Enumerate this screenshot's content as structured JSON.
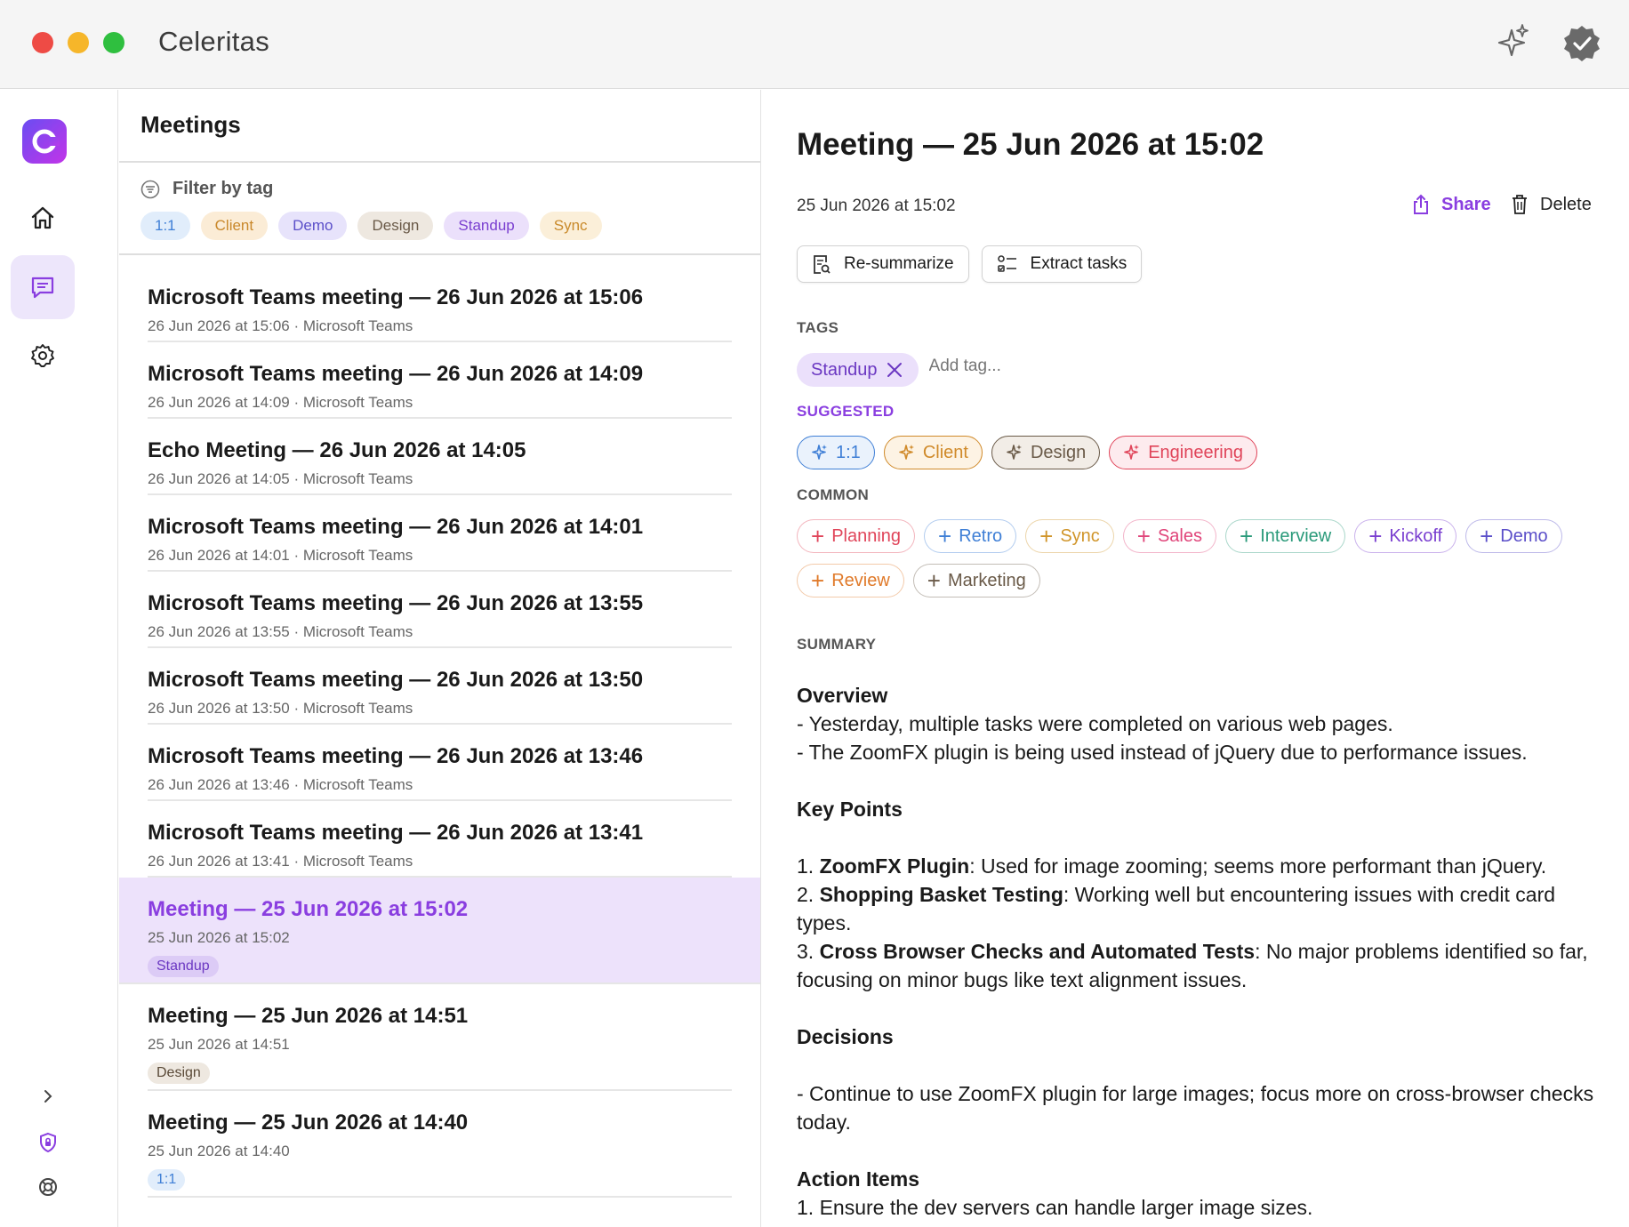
{
  "app": {
    "title": "Celeritas"
  },
  "list": {
    "header": "Meetings",
    "filter_label": "Filter by tag",
    "filter_tags": [
      {
        "label": "1:1",
        "bg": "#e1edfb",
        "fg": "#3f7fd6"
      },
      {
        "label": "Client",
        "bg": "#fbecd6",
        "fg": "#c9882b"
      },
      {
        "label": "Demo",
        "bg": "#e7e3fb",
        "fg": "#5b4fc9"
      },
      {
        "label": "Design",
        "bg": "#eee8e0",
        "fg": "#6a5a48"
      },
      {
        "label": "Standup",
        "bg": "#ebe0fb",
        "fg": "#7a3fd0"
      },
      {
        "label": "Sync",
        "bg": "#fbefd9",
        "fg": "#c98a2b"
      }
    ],
    "meetings": [
      {
        "title": "Microsoft Teams meeting — 26 Jun 2026 at 15:06",
        "sub": "26 Jun 2026 at 15:06 · Microsoft Teams"
      },
      {
        "title": "Microsoft Teams meeting — 26 Jun 2026 at 14:09",
        "sub": "26 Jun 2026 at 14:09 · Microsoft Teams"
      },
      {
        "title": "Echo Meeting — 26 Jun 2026 at 14:05",
        "sub": "26 Jun 2026 at 14:05 · Microsoft Teams"
      },
      {
        "title": "Microsoft Teams meeting — 26 Jun 2026 at 14:01",
        "sub": "26 Jun 2026 at 14:01 · Microsoft Teams"
      },
      {
        "title": "Microsoft Teams meeting — 26 Jun 2026 at 13:55",
        "sub": "26 Jun 2026 at 13:55 · Microsoft Teams"
      },
      {
        "title": "Microsoft Teams meeting — 26 Jun 2026 at 13:50",
        "sub": "26 Jun 2026 at 13:50 · Microsoft Teams"
      },
      {
        "title": "Microsoft Teams meeting — 26 Jun 2026 at 13:46",
        "sub": "26 Jun 2026 at 13:46 · Microsoft Teams"
      },
      {
        "title": "Microsoft Teams meeting — 26 Jun 2026 at 13:41",
        "sub": "26 Jun 2026 at 13:41 · Microsoft Teams"
      },
      {
        "title": "Meeting — 25 Jun 2026 at 15:02",
        "sub": "25 Jun 2026 at 15:02",
        "tag": "Standup",
        "tag_bg": "#dccbf6",
        "tag_fg": "#6b38c2"
      },
      {
        "title": "Meeting — 25 Jun 2026 at 14:51",
        "sub": "25 Jun 2026 at 14:51",
        "tag": "Design",
        "tag_bg": "#eee8e0",
        "tag_fg": "#5a4a38"
      },
      {
        "title": "Meeting — 25 Jun 2026 at 14:40",
        "sub": "25 Jun 2026 at 14:40",
        "tag": "1:1",
        "tag_bg": "#e1edfb",
        "tag_fg": "#3f7fd6"
      }
    ]
  },
  "detail": {
    "title": "Meeting — 25 Jun 2026 at 15:02",
    "date": "25 Jun 2026 at 15:02",
    "share_label": "Share",
    "delete_label": "Delete",
    "resummarize_label": "Re-summarize",
    "extract_label": "Extract tasks",
    "tags_label": "TAGS",
    "current_tag": "Standup",
    "add_tag_placeholder": "Add tag...",
    "suggested_label": "SUGGESTED",
    "suggested": [
      {
        "label": "1:1",
        "color": "#3f7fd6",
        "bg": "#eaf2fc"
      },
      {
        "label": "Client",
        "color": "#d08a2a",
        "bg": "#fdf3e4"
      },
      {
        "label": "Design",
        "color": "#6a5a48",
        "bg": "#f2ede7"
      },
      {
        "label": "Engineering",
        "color": "#e0455a",
        "bg": "#fdebee"
      }
    ],
    "common_label": "COMMON",
    "common_row1": [
      {
        "label": "Planning",
        "color": "#e0455a"
      },
      {
        "label": "Retro",
        "color": "#3f7fd6"
      },
      {
        "label": "Sync",
        "color": "#d0952a"
      },
      {
        "label": "Sales",
        "color": "#e0457a"
      },
      {
        "label": "Interview",
        "color": "#2a9a7a"
      },
      {
        "label": "Kickoff",
        "color": "#7a3fd0"
      },
      {
        "label": "Demo",
        "color": "#5b4fc9"
      }
    ],
    "common_row2": [
      {
        "label": "Review",
        "color": "#e07a2a"
      },
      {
        "label": "Marketing",
        "color": "#6a5a48"
      }
    ],
    "summary_label": "SUMMARY",
    "summary": {
      "overview_h": "Overview",
      "overview_1": "- Yesterday, multiple tasks were completed on various web pages.",
      "overview_2": "- The ZoomFX plugin is being used instead of jQuery due to performance issues.",
      "keypoints_h": "Key Points",
      "kp1_num": "1. ",
      "kp1_b": "ZoomFX Plugin",
      "kp1_t": ": Used for image zooming; seems more performant than jQuery.",
      "kp2_num": "2. ",
      "kp2_b": "Shopping Basket Testing",
      "kp2_t": ": Working well but encountering issues with credit card types.",
      "kp3_num": "3. ",
      "kp3_b": "Cross Browser Checks and Automated Tests",
      "kp3_t": ": No major problems identified so far, focusing on minor bugs like text alignment issues.",
      "decisions_h": "Decisions",
      "decision_1": "- Continue to use ZoomFX plugin for large images; focus more on cross-browser checks today.",
      "actions_h": "Action Items",
      "action_1": "1. Ensure the dev servers can handle larger image sizes."
    }
  }
}
